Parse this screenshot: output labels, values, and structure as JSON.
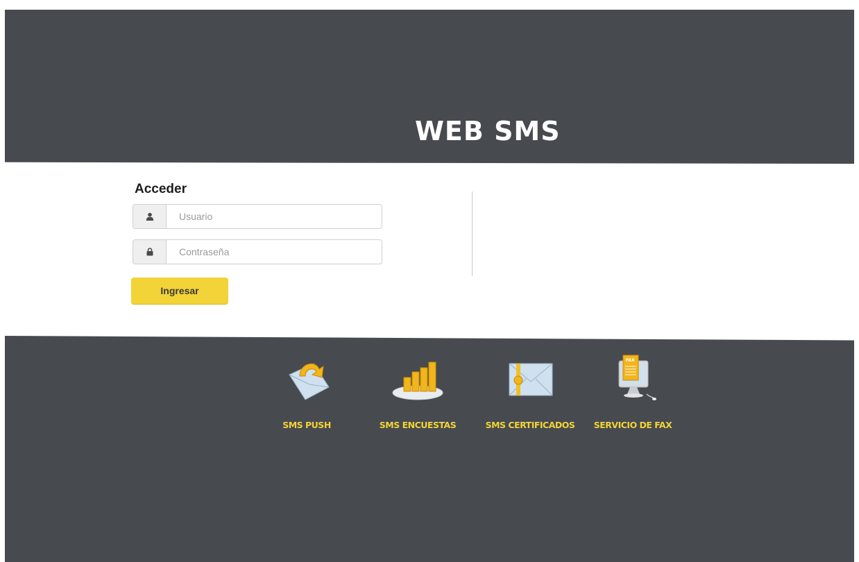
{
  "header": {
    "title": "WEB SMS"
  },
  "login": {
    "heading": "Acceder",
    "username_placeholder": "Usuario",
    "password_placeholder": "Contraseña",
    "submit_label": "Ingresar"
  },
  "services": [
    {
      "label": "SMS PUSH",
      "icon": "envelope-refresh-icon"
    },
    {
      "label": "SMS ENCUESTAS",
      "icon": "bar-chart-icon"
    },
    {
      "label": "SMS CERTIFICADOS",
      "icon": "certified-envelope-icon"
    },
    {
      "label": "SERVICIO DE FAX",
      "icon": "fax-monitor-icon"
    }
  ],
  "colors": {
    "band": "#474a4f",
    "accent": "#f2d338"
  }
}
